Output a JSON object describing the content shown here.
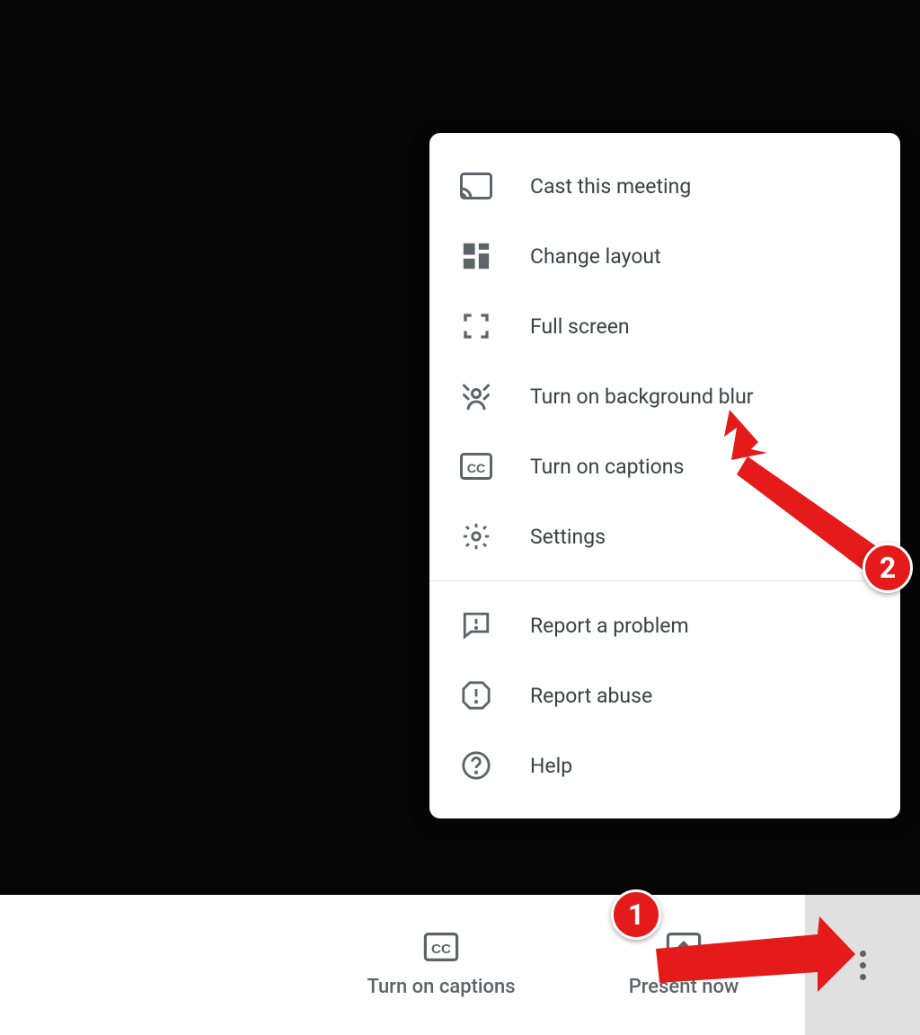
{
  "menu": {
    "group1": [
      {
        "icon": "cast-icon",
        "label": "Cast this meeting"
      },
      {
        "icon": "layout-icon",
        "label": "Change layout"
      },
      {
        "icon": "fullscreen-icon",
        "label": "Full screen"
      },
      {
        "icon": "blur-icon",
        "label": "Turn on background blur"
      },
      {
        "icon": "cc-icon",
        "label": "Turn on captions"
      },
      {
        "icon": "settings-icon",
        "label": "Settings"
      }
    ],
    "group2": [
      {
        "icon": "feedback-icon",
        "label": "Report a problem"
      },
      {
        "icon": "octagon-icon",
        "label": "Report abuse"
      },
      {
        "icon": "help-icon",
        "label": "Help"
      }
    ]
  },
  "bottom_bar": {
    "captions_label": "Turn on captions",
    "present_label": "Present now"
  },
  "annotations": {
    "step1": "1",
    "step2": "2"
  },
  "colors": {
    "icon_gray": "#5f6368",
    "annotation_red": "#e51a1a"
  }
}
